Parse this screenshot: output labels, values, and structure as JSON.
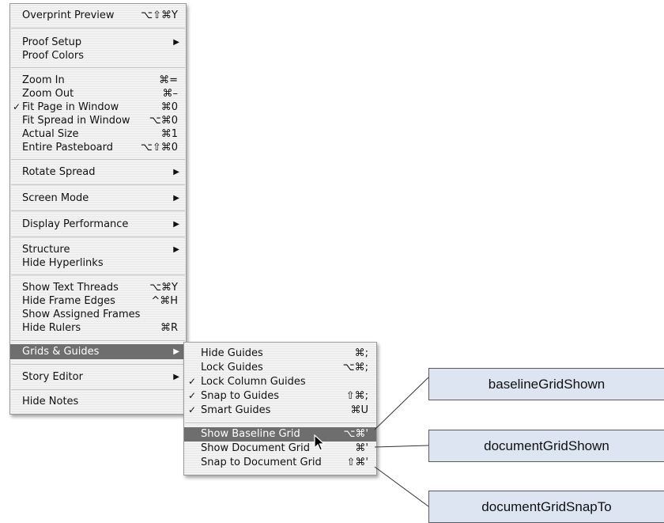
{
  "main_menu": {
    "items": [
      {
        "label": "Overprint Preview",
        "shortcut": "⌥⇧⌘Y",
        "checked": false,
        "submenu": false
      },
      {
        "label": "Proof Setup",
        "shortcut": "",
        "checked": false,
        "submenu": true
      },
      {
        "label": "Proof Colors",
        "shortcut": "",
        "checked": false,
        "submenu": false
      },
      {
        "label": "Zoom In",
        "shortcut": "⌘=",
        "checked": false,
        "submenu": false
      },
      {
        "label": "Zoom Out",
        "shortcut": "⌘–",
        "checked": false,
        "submenu": false
      },
      {
        "label": "Fit Page in Window",
        "shortcut": "⌘0",
        "checked": true,
        "submenu": false
      },
      {
        "label": "Fit Spread in Window",
        "shortcut": "⌥⌘0",
        "checked": false,
        "submenu": false
      },
      {
        "label": "Actual Size",
        "shortcut": "⌘1",
        "checked": false,
        "submenu": false
      },
      {
        "label": "Entire Pasteboard",
        "shortcut": "⌥⇧⌘0",
        "checked": false,
        "submenu": false
      },
      {
        "label": "Rotate Spread",
        "shortcut": "",
        "checked": false,
        "submenu": true
      },
      {
        "label": "Screen Mode",
        "shortcut": "",
        "checked": false,
        "submenu": true
      },
      {
        "label": "Display Performance",
        "shortcut": "",
        "checked": false,
        "submenu": true
      },
      {
        "label": "Structure",
        "shortcut": "",
        "checked": false,
        "submenu": true
      },
      {
        "label": "Hide Hyperlinks",
        "shortcut": "",
        "checked": false,
        "submenu": false
      },
      {
        "label": "Show Text Threads",
        "shortcut": "⌥⌘Y",
        "checked": false,
        "submenu": false
      },
      {
        "label": "Hide Frame Edges",
        "shortcut": "^⌘H",
        "checked": false,
        "submenu": false
      },
      {
        "label": "Show Assigned Frames",
        "shortcut": "",
        "checked": false,
        "submenu": false
      },
      {
        "label": "Hide Rulers",
        "shortcut": "⌘R",
        "checked": false,
        "submenu": false
      },
      {
        "label": "Grids & Guides",
        "shortcut": "",
        "checked": false,
        "submenu": true,
        "highlighted": true
      },
      {
        "label": "Story Editor",
        "shortcut": "",
        "checked": false,
        "submenu": true
      },
      {
        "label": "Hide Notes",
        "shortcut": "",
        "checked": false,
        "submenu": false
      }
    ]
  },
  "sub_menu": {
    "items": [
      {
        "label": "Hide Guides",
        "shortcut": "⌘;",
        "checked": false
      },
      {
        "label": "Lock Guides",
        "shortcut": "⌥⌘;",
        "checked": false
      },
      {
        "label": "Lock Column Guides",
        "shortcut": "",
        "checked": true
      },
      {
        "label": "Snap to Guides",
        "shortcut": "⇧⌘;",
        "checked": true
      },
      {
        "label": "Smart Guides",
        "shortcut": "⌘U",
        "checked": true
      },
      {
        "label": "Show Baseline Grid",
        "shortcut": "⌥⌘'",
        "checked": false,
        "highlighted": true
      },
      {
        "label": "Show Document Grid",
        "shortcut": "⌘'",
        "checked": false
      },
      {
        "label": "Snap to Document Grid",
        "shortcut": "⇧⌘'",
        "checked": false
      }
    ]
  },
  "symbols": {
    "check": "✓",
    "arrow": "▶"
  },
  "callouts": [
    {
      "text": "baselineGridShown"
    },
    {
      "text": "documentGridShown"
    },
    {
      "text": "documentGridSnapTo"
    }
  ],
  "colors": {
    "highlight": "#6e6e6e",
    "callout_fill": "#dde5f2",
    "menu_bg": "#ececec"
  },
  "icons": {
    "cursor": "arrow-cursor-icon",
    "submenu": "chevron-right-icon",
    "check": "checkmark-icon"
  }
}
